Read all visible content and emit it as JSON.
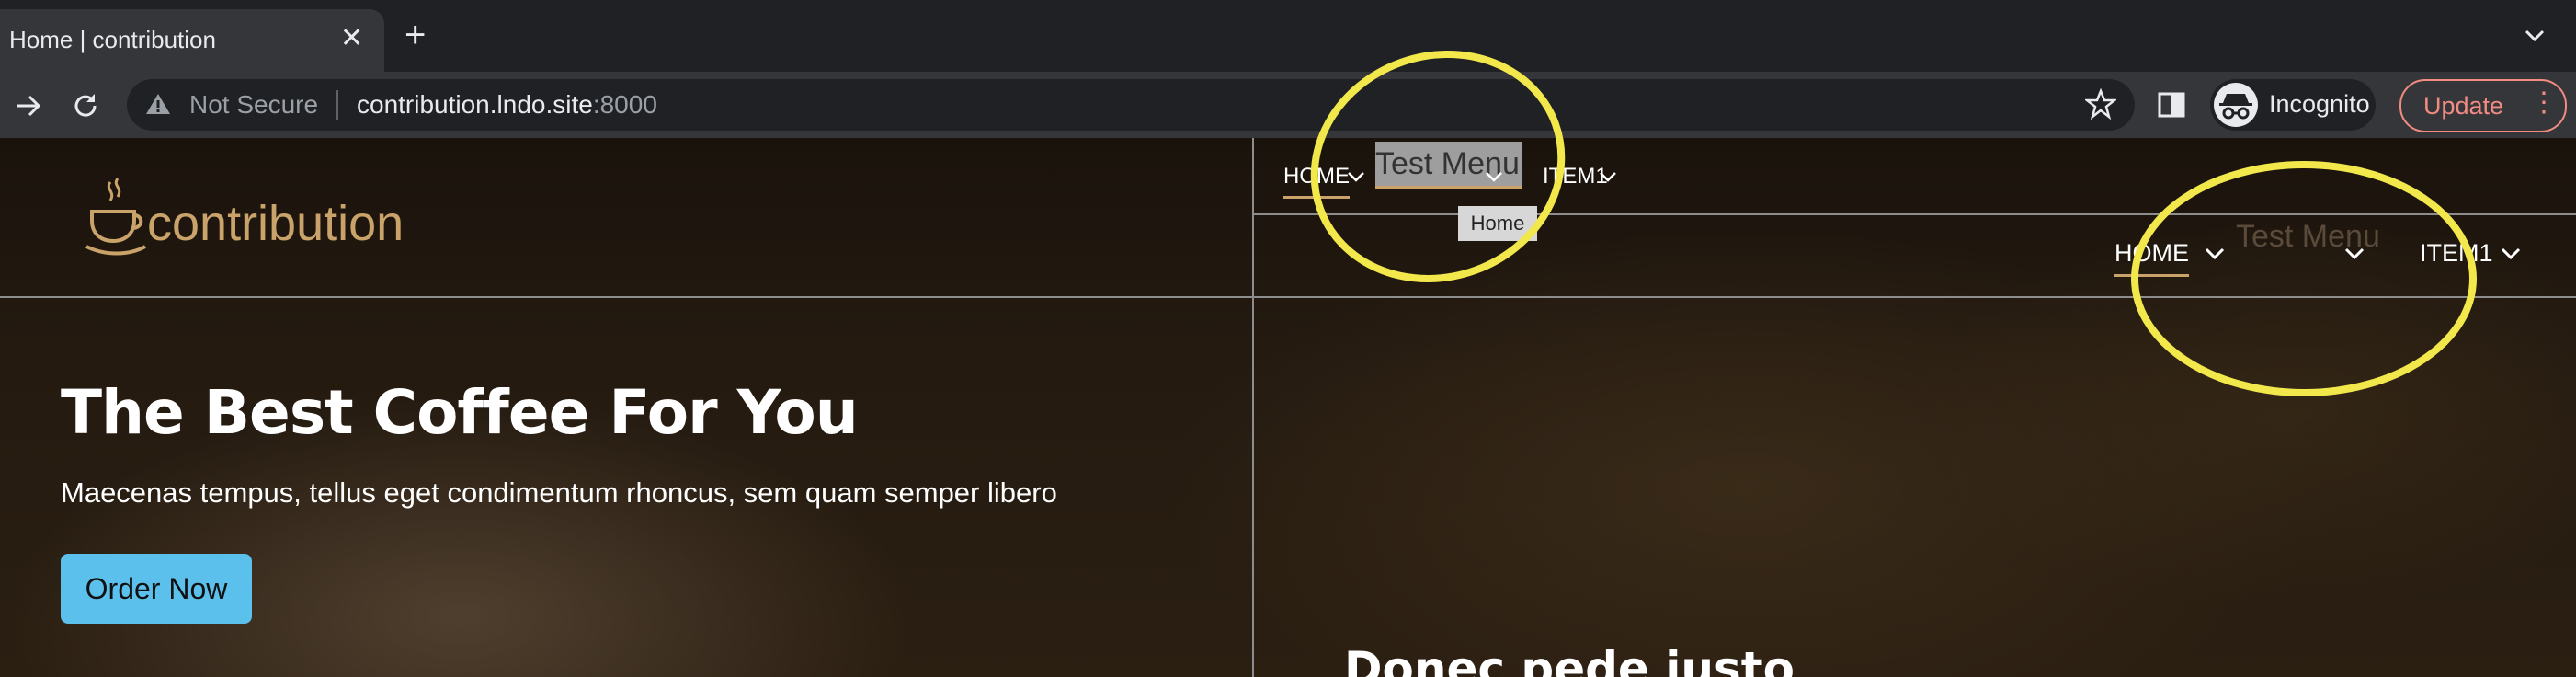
{
  "browser": {
    "tab_title": "Home | contribution",
    "tab_close": "✕",
    "new_tab": "+",
    "security_label": "Not Secure",
    "url_host": "contribution.lndo.site",
    "url_port": ":8000",
    "profile_label": "Incognito",
    "update_label": "Update",
    "menu_dots": "⋮"
  },
  "site": {
    "logo_text": "contribution",
    "hero": {
      "title": "The Best Coffee For You",
      "subtitle": "Maecenas tempus, tellus eget condimentum rhoncus, sem quam semper libero",
      "cta_label": "Order Now"
    },
    "right_heading": "Donec pede justo",
    "nav_top": {
      "home": "HOME",
      "test_menu": "Test Menu",
      "item1": "ITEM1",
      "tooltip": "Home"
    },
    "nav_bottom": {
      "home": "HOME",
      "test_menu": "Test Menu",
      "item1": "ITEM1"
    }
  },
  "colors": {
    "accent_gold": "#c9a36a",
    "cta_blue": "#5bc0eb",
    "annotation_yellow": "#f2e84b",
    "update_red": "#f28b82"
  },
  "icons": [
    "back-icon",
    "forward-icon",
    "reload-icon",
    "warning-icon",
    "star-icon",
    "sidepanel-icon",
    "incognito-icon",
    "chevron-down-icon",
    "coffee-cup-icon"
  ]
}
